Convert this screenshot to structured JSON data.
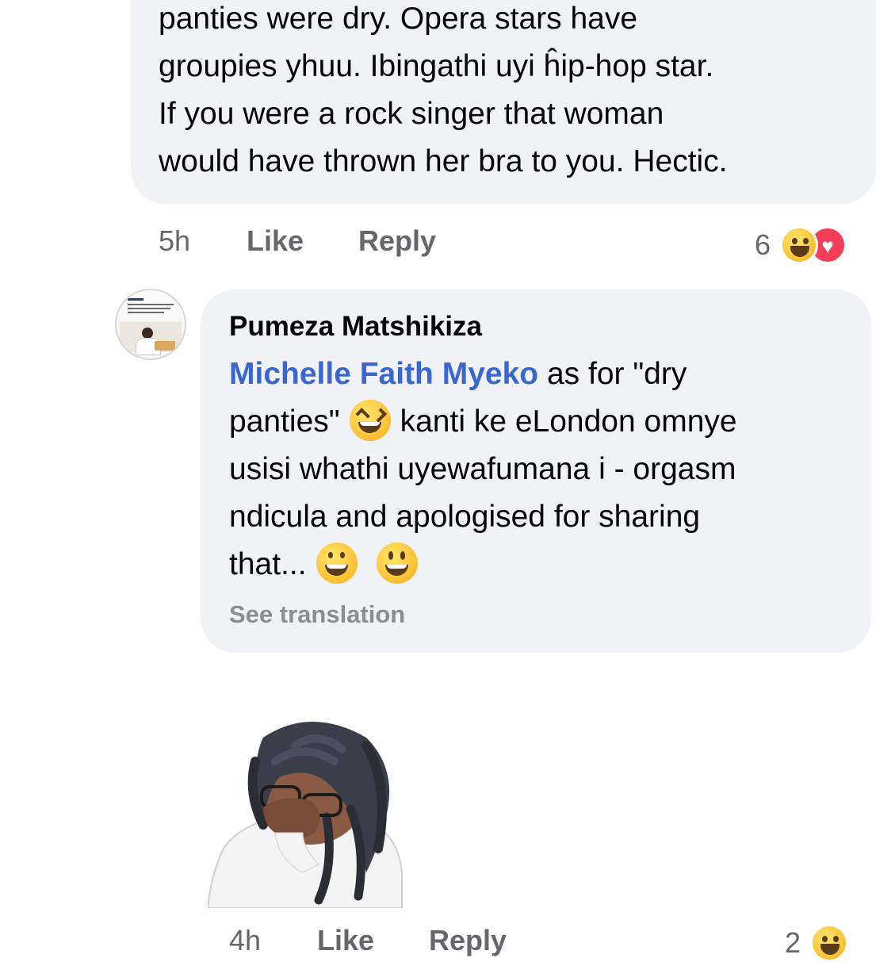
{
  "comment1": {
    "lines": [
      "panties were dry. Opera stars have",
      "groupies yhuu. Ibingathi uyi ĥip-hop star.",
      "If you were a rock singer that woman",
      "would have thrown her bra to you. Hectic."
    ],
    "time": "5h",
    "like_label": "Like",
    "reply_label": "Reply",
    "reaction_count": "6",
    "reaction_icons": [
      "haha-icon",
      "love-icon"
    ]
  },
  "comment2": {
    "author": "Pumeza Matshikiza",
    "mention": "Michelle Faith Myeko",
    "line1_rest": "as for \"dry",
    "line2_a": "panties\"",
    "line2_b": "kanti ke eLondon omnye",
    "line3": "usisi whathi uyewafumana i - orgasm",
    "line4": "ndicula and apologised for sharing",
    "line5": "that...",
    "see_translation": "See translation"
  },
  "comment3": {
    "time": "4h",
    "like_label": "Like",
    "reply_label": "Reply",
    "reaction_count": "2",
    "reaction_icons": [
      "haha-icon"
    ]
  },
  "colors": {
    "bubble": "#f0f2f5",
    "mention": "#3a66cf",
    "meta": "#65676b",
    "love": "#f33e58"
  }
}
